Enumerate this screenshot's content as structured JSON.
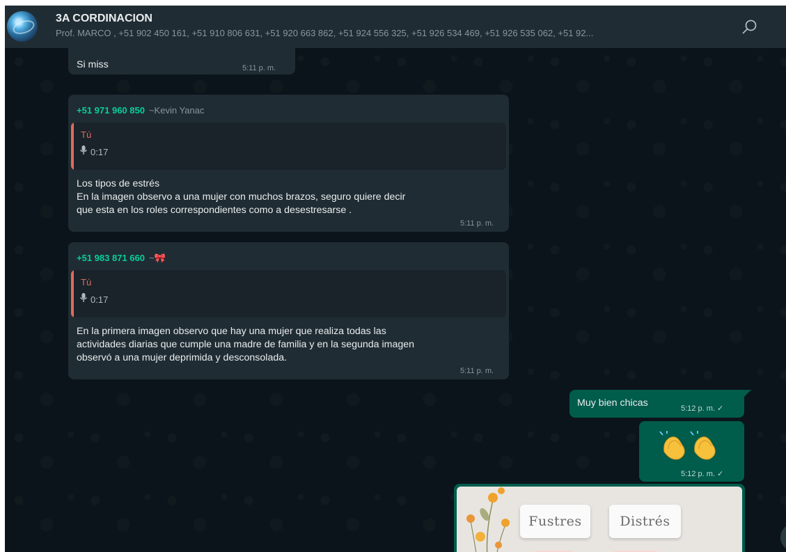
{
  "header": {
    "group_name": "3A CORDINACION",
    "members": "Prof. MARCO , +51 902 450 161, +51 910 806 631, +51 920 663 862, +51 924 556 325, +51 926 534 469, +51 926 535 062, +51 92..."
  },
  "messages": [
    {
      "type": "incoming",
      "text": "Si miss",
      "time": "5:11 p. m."
    },
    {
      "type": "incoming",
      "sender_number": "+51 971 960 850",
      "sender_alias": "~Kevin Yanac",
      "quote": {
        "author": "Tú",
        "audio_duration": "0:17"
      },
      "lines": [
        "Los tipos de estrés",
        "En la imagen observo a una mujer con muchos brazos, seguro quiere decir",
        "que esta en los roles correspondientes como a desestresarse ."
      ],
      "time": "5:11 p. m."
    },
    {
      "type": "incoming",
      "sender_number": "+51 983 871 660",
      "sender_alias": "~🎀",
      "quote": {
        "author": "Tú",
        "audio_duration": "0:17"
      },
      "lines": [
        "En la  primera imagen observo que hay una mujer que realiza todas las",
        "actividades diarias que cumple una madre de familia y en la segunda imagen",
        "observó a una mujer deprimida y desconsolada."
      ],
      "time": "5:11 p. m."
    },
    {
      "type": "outgoing",
      "text": "Muy bien chicas",
      "time": "5:12 p. m. ✓"
    },
    {
      "type": "outgoing",
      "emoji": "👏👏",
      "time": "5:12 p. m. ✓"
    },
    {
      "type": "outgoing-image",
      "card_left": "Fustres",
      "card_right": "Distrés"
    }
  ],
  "icons": {
    "search": "search-icon",
    "mic": "mic-icon",
    "check": "single-check-icon"
  },
  "colors": {
    "background": "#0b141a",
    "header": "#202c33",
    "incoming_bubble": "#202c33",
    "outgoing_bubble": "#005c4b",
    "sender_green": "#06cf9c",
    "quote_red": "#e26a5a"
  }
}
